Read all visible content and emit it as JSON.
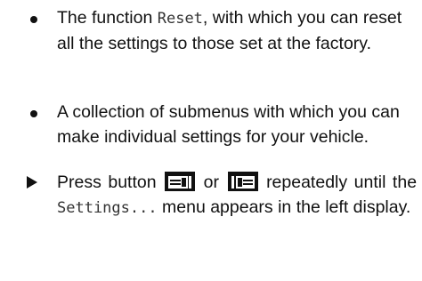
{
  "items": [
    {
      "marker": "bullet",
      "text_before": "The function ",
      "code": "Reset",
      "text_after": ", with which you can reset all the settings to those set at the factory."
    },
    {
      "marker": "bullet",
      "text": "A collection of submenus with which you can make individual settings for your vehicle."
    },
    {
      "marker": "arrow",
      "text_press": "Press button",
      "text_or": "or",
      "text_repeat": "repeatedly until the",
      "code": "Settings...",
      "text_after": "menu appears in the left display.",
      "icons": [
        "display-left-button-icon",
        "display-right-button-icon"
      ]
    }
  ]
}
